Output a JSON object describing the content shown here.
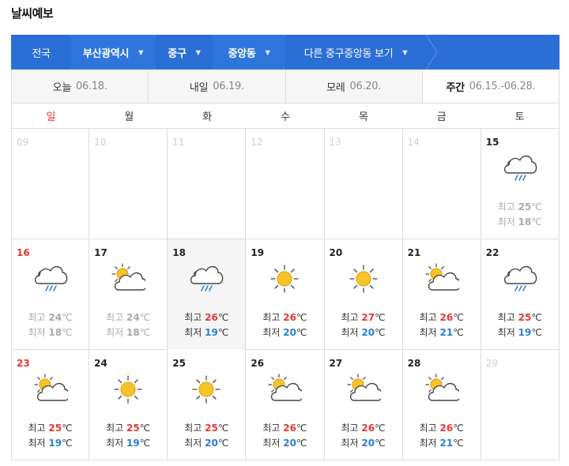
{
  "page": {
    "title": "날씨예보"
  },
  "breadcrumb": [
    {
      "label": "전국",
      "strong": false,
      "caret": false
    },
    {
      "label": "부산광역시",
      "strong": true,
      "caret": true
    },
    {
      "label": "중구",
      "strong": true,
      "caret": true
    },
    {
      "label": "중앙동",
      "strong": true,
      "caret": true
    },
    {
      "label": "다른 중구중앙동 보기",
      "strong": false,
      "caret": true
    }
  ],
  "tabs": [
    {
      "name": "오늘",
      "date": "06.18."
    },
    {
      "name": "내일",
      "date": "06.19."
    },
    {
      "name": "모레",
      "date": "06.20."
    },
    {
      "name": "주간",
      "date": "06.15.-06.28."
    }
  ],
  "weekdays": [
    "일",
    "월",
    "화",
    "수",
    "목",
    "금",
    "토"
  ],
  "labels": {
    "high": "최고",
    "low": "최저",
    "unit": "℃"
  },
  "colors": {
    "primary": "#2a6fd6",
    "sunday": "#e53935",
    "high": "#e53935",
    "low": "#2a7fd0"
  },
  "weeks": [
    [
      {
        "day": "09",
        "dim": true
      },
      {
        "day": "10",
        "dim": true
      },
      {
        "day": "11",
        "dim": true
      },
      {
        "day": "12",
        "dim": true
      },
      {
        "day": "13",
        "dim": true
      },
      {
        "day": "14",
        "dim": true
      },
      {
        "day": "15",
        "icon": "rain-icon",
        "high": "25",
        "low": "18",
        "past": true
      }
    ],
    [
      {
        "day": "16",
        "icon": "rain-icon",
        "high": "24",
        "low": "18",
        "past": true
      },
      {
        "day": "17",
        "icon": "partly-cloudy-icon",
        "high": "24",
        "low": "18",
        "past": true
      },
      {
        "day": "18",
        "icon": "rain-icon",
        "high": "26",
        "low": "19",
        "today": true
      },
      {
        "day": "19",
        "icon": "sun-icon",
        "high": "26",
        "low": "20"
      },
      {
        "day": "20",
        "icon": "sun-icon",
        "high": "27",
        "low": "20"
      },
      {
        "day": "21",
        "icon": "partly-cloudy-icon",
        "high": "26",
        "low": "21"
      },
      {
        "day": "22",
        "icon": "rain-icon",
        "high": "25",
        "low": "19"
      }
    ],
    [
      {
        "day": "23",
        "icon": "partly-cloudy-icon",
        "high": "25",
        "low": "19"
      },
      {
        "day": "24",
        "icon": "sun-icon",
        "high": "25",
        "low": "19"
      },
      {
        "day": "25",
        "icon": "sun-icon",
        "high": "25",
        "low": "20"
      },
      {
        "day": "26",
        "icon": "partly-cloudy-icon",
        "high": "26",
        "low": "20"
      },
      {
        "day": "27",
        "icon": "partly-cloudy-icon",
        "high": "26",
        "low": "20"
      },
      {
        "day": "28",
        "icon": "partly-cloudy-icon",
        "high": "26",
        "low": "21"
      },
      {
        "day": "29",
        "dim": true
      }
    ]
  ]
}
